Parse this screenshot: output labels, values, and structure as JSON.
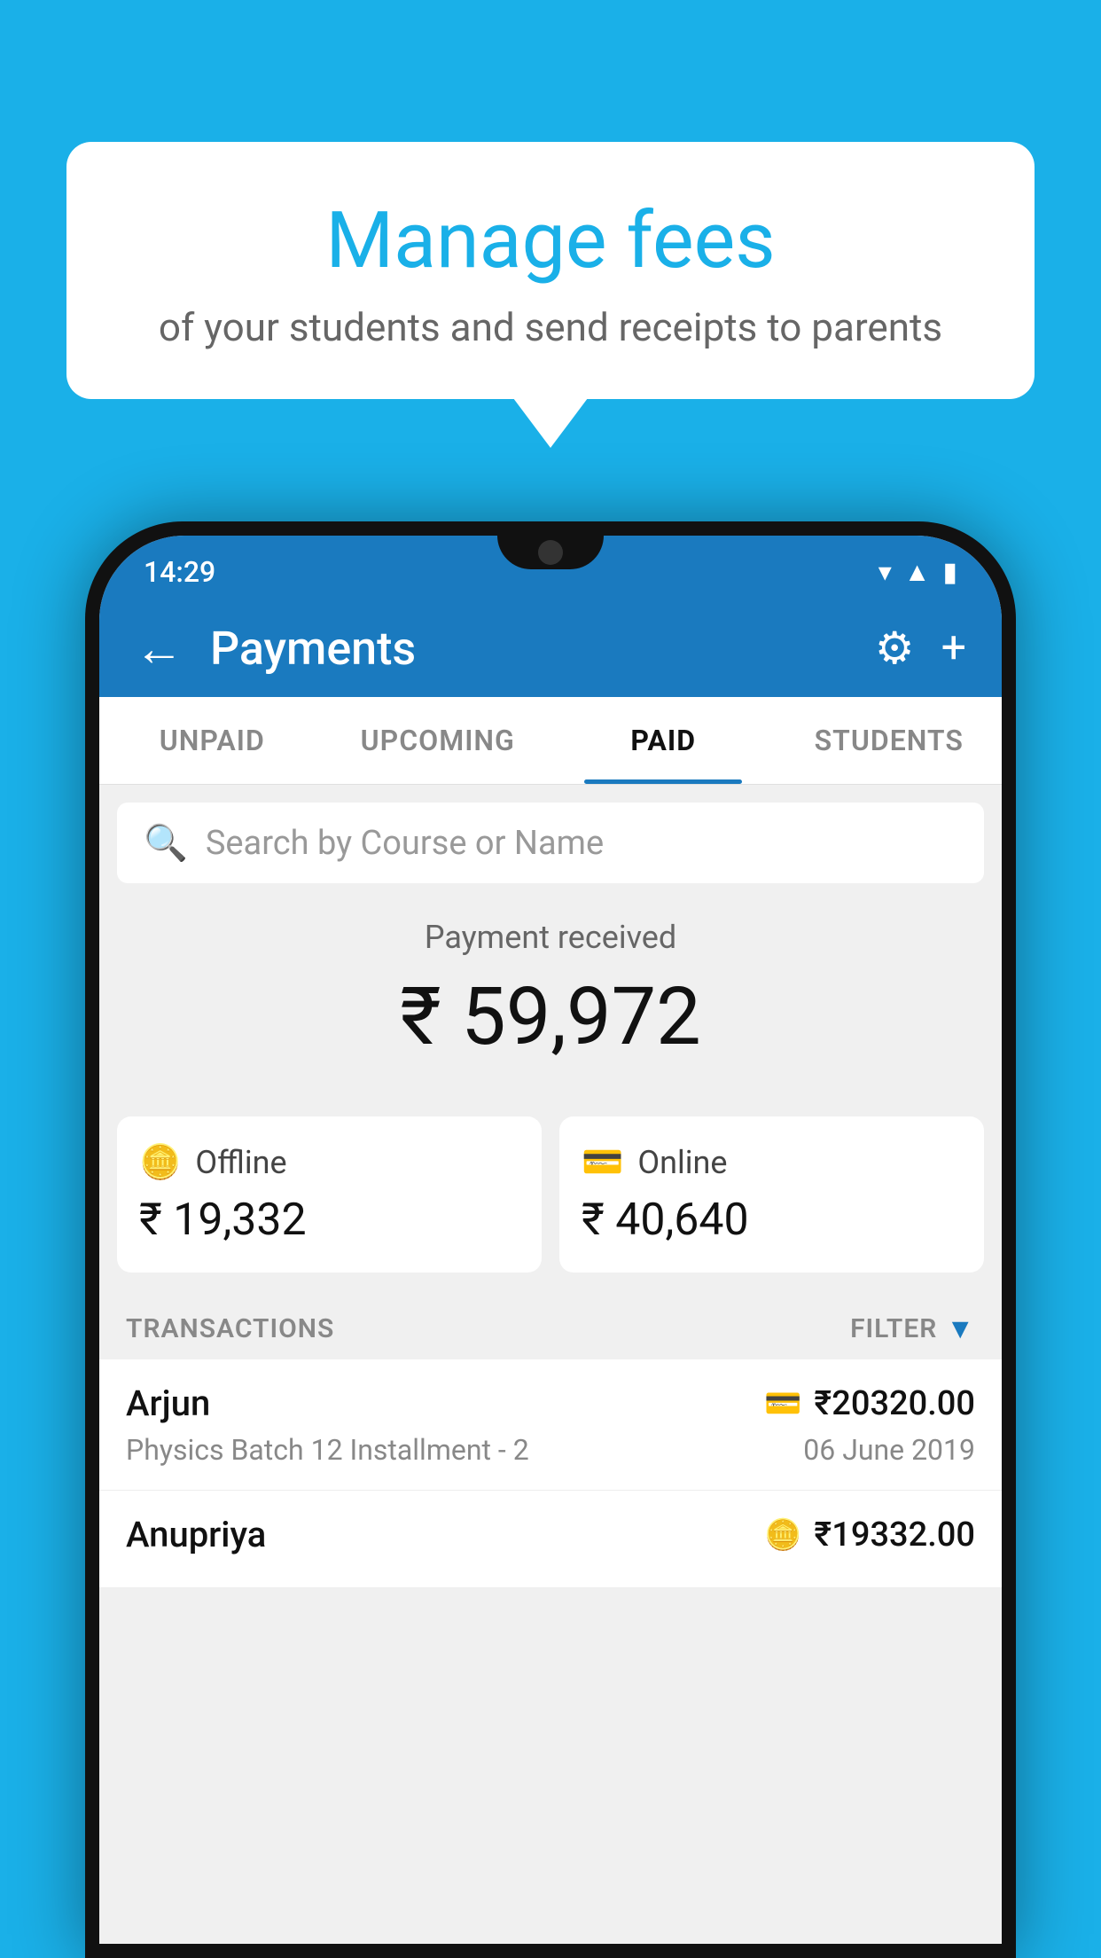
{
  "background_color": "#1ab0e8",
  "speech_bubble": {
    "title": "Manage fees",
    "subtitle": "of your students and send receipts to parents"
  },
  "status_bar": {
    "time": "14:29",
    "icons": [
      "wifi",
      "signal",
      "battery"
    ]
  },
  "app_bar": {
    "title": "Payments",
    "back_icon": "←",
    "gear_icon": "⚙",
    "plus_icon": "+"
  },
  "tabs": [
    {
      "label": "UNPAID",
      "active": false
    },
    {
      "label": "UPCOMING",
      "active": false
    },
    {
      "label": "PAID",
      "active": true
    },
    {
      "label": "STUDENTS",
      "active": false
    }
  ],
  "search": {
    "placeholder": "Search by Course or Name"
  },
  "payment_summary": {
    "label": "Payment received",
    "total": "₹ 59,972",
    "offline": {
      "type": "Offline",
      "amount": "₹ 19,332"
    },
    "online": {
      "type": "Online",
      "amount": "₹ 40,640"
    }
  },
  "transactions": {
    "label": "TRANSACTIONS",
    "filter_label": "FILTER",
    "items": [
      {
        "name": "Arjun",
        "description": "Physics Batch 12 Installment - 2",
        "amount": "₹20320.00",
        "type": "online",
        "date": "06 June 2019"
      },
      {
        "name": "Anupriya",
        "description": "",
        "amount": "₹19332.00",
        "type": "offline",
        "date": ""
      }
    ]
  }
}
